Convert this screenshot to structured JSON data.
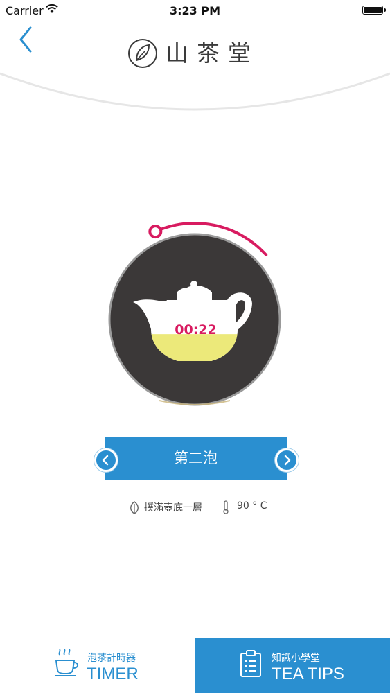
{
  "status_bar": {
    "carrier": "Carrier",
    "time": "3:23 PM"
  },
  "header": {
    "logo_text": "山茶堂",
    "back_icon": "chevron-left-icon"
  },
  "timer": {
    "display": "00:22",
    "progress": 0.2,
    "tea_fill": 0.35
  },
  "infusion": {
    "label": "第二泡",
    "prev_icon": "chevron-left-circle-icon",
    "next_icon": "chevron-right-circle-icon"
  },
  "brew_info": {
    "instruction": "撲滿壺底一層",
    "temperature": "90 ° C",
    "leaf_icon": "leaf-icon",
    "thermometer_icon": "thermometer-icon"
  },
  "tabs": {
    "timer": {
      "sub": "泡茶計時器",
      "main": "TIMER",
      "icon": "teacup-icon"
    },
    "tips": {
      "sub": "知識小學堂",
      "main": "TEA TIPS",
      "icon": "clipboard-icon"
    }
  },
  "colors": {
    "accent_blue": "#2a8fd0",
    "timer_pink": "#d81b60",
    "dial_dark": "#3b3838",
    "tea_yellow": "#ece97a"
  }
}
